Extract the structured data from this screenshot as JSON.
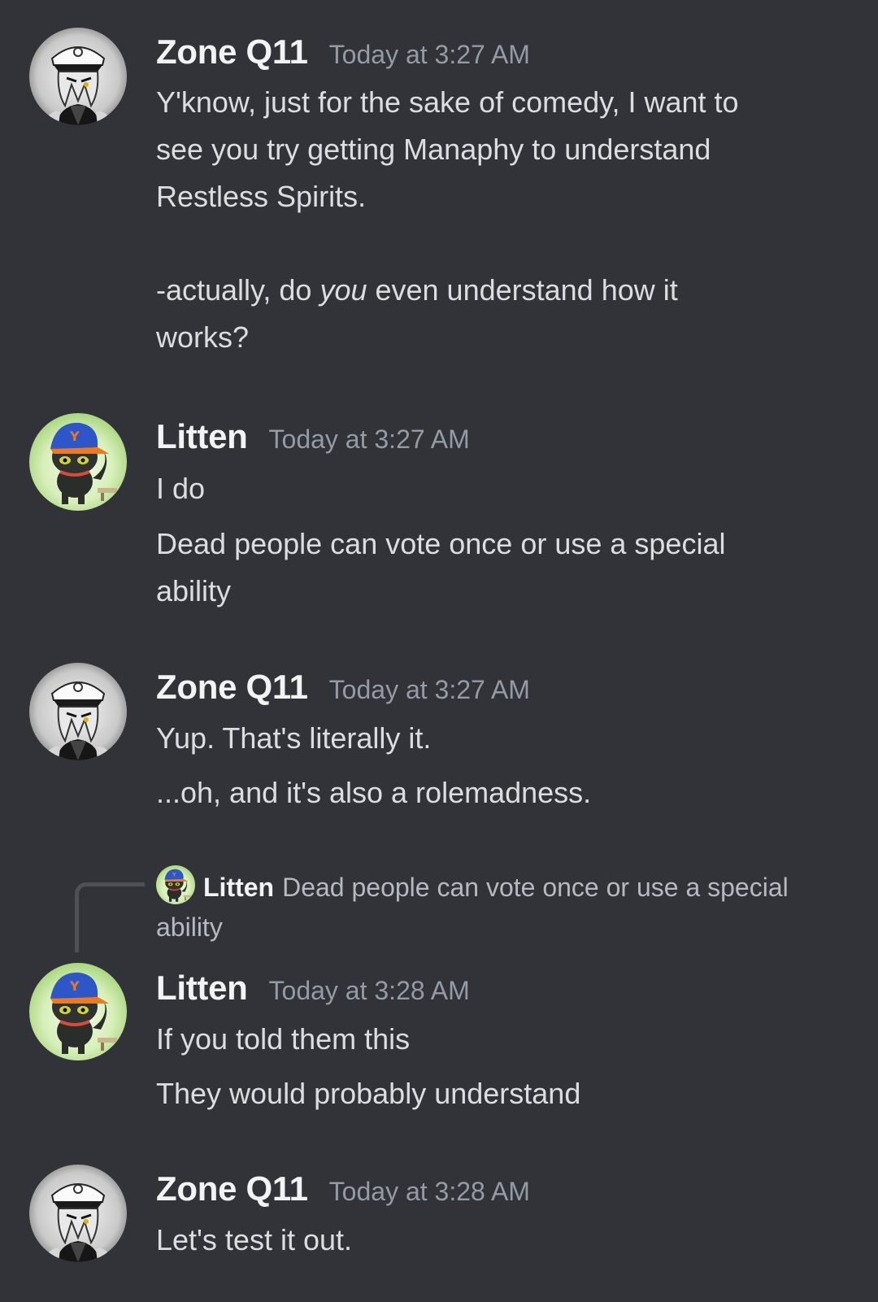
{
  "messages": [
    {
      "author": "Zone Q11",
      "avatar": "captain-avatar-icon",
      "timestamp": "Today at 3:27 AM",
      "lines": [
        "Y'know, just for the sake of comedy, I want to",
        "see you try getting Manaphy to understand",
        "Restless Spirits."
      ],
      "line2_prefix": "-actually, do ",
      "line2_italic": "you",
      "line2_suffix": " even understand how it",
      "line3": "works?"
    },
    {
      "author": "Litten",
      "avatar": "litten-cat-avatar-icon",
      "timestamp": "Today at 3:27 AM",
      "lines": [
        "I do",
        "Dead people can vote once or use a special",
        "ability"
      ]
    },
    {
      "author": "Zone Q11",
      "avatar": "captain-avatar-icon",
      "timestamp": "Today at 3:27 AM",
      "lines": [
        "Yup. That's literally it.",
        "...oh, and it's also a rolemadness."
      ]
    },
    {
      "reply": {
        "author": "Litten",
        "text_line1": "Dead people can vote once or use a special",
        "text_line2": "ability"
      },
      "author": "Litten",
      "avatar": "litten-cat-avatar-icon",
      "timestamp": "Today at 3:28 AM",
      "lines": [
        "If you told them this",
        "They would probably understand"
      ]
    },
    {
      "author": "Zone Q11",
      "avatar": "captain-avatar-icon",
      "timestamp": "Today at 3:28 AM",
      "lines": [
        "Let's test it out."
      ]
    }
  ],
  "colors": {
    "background": "#313338",
    "username": "#f2f3f5",
    "timestamp": "#949ba4",
    "message_text": "#dbdee1"
  }
}
